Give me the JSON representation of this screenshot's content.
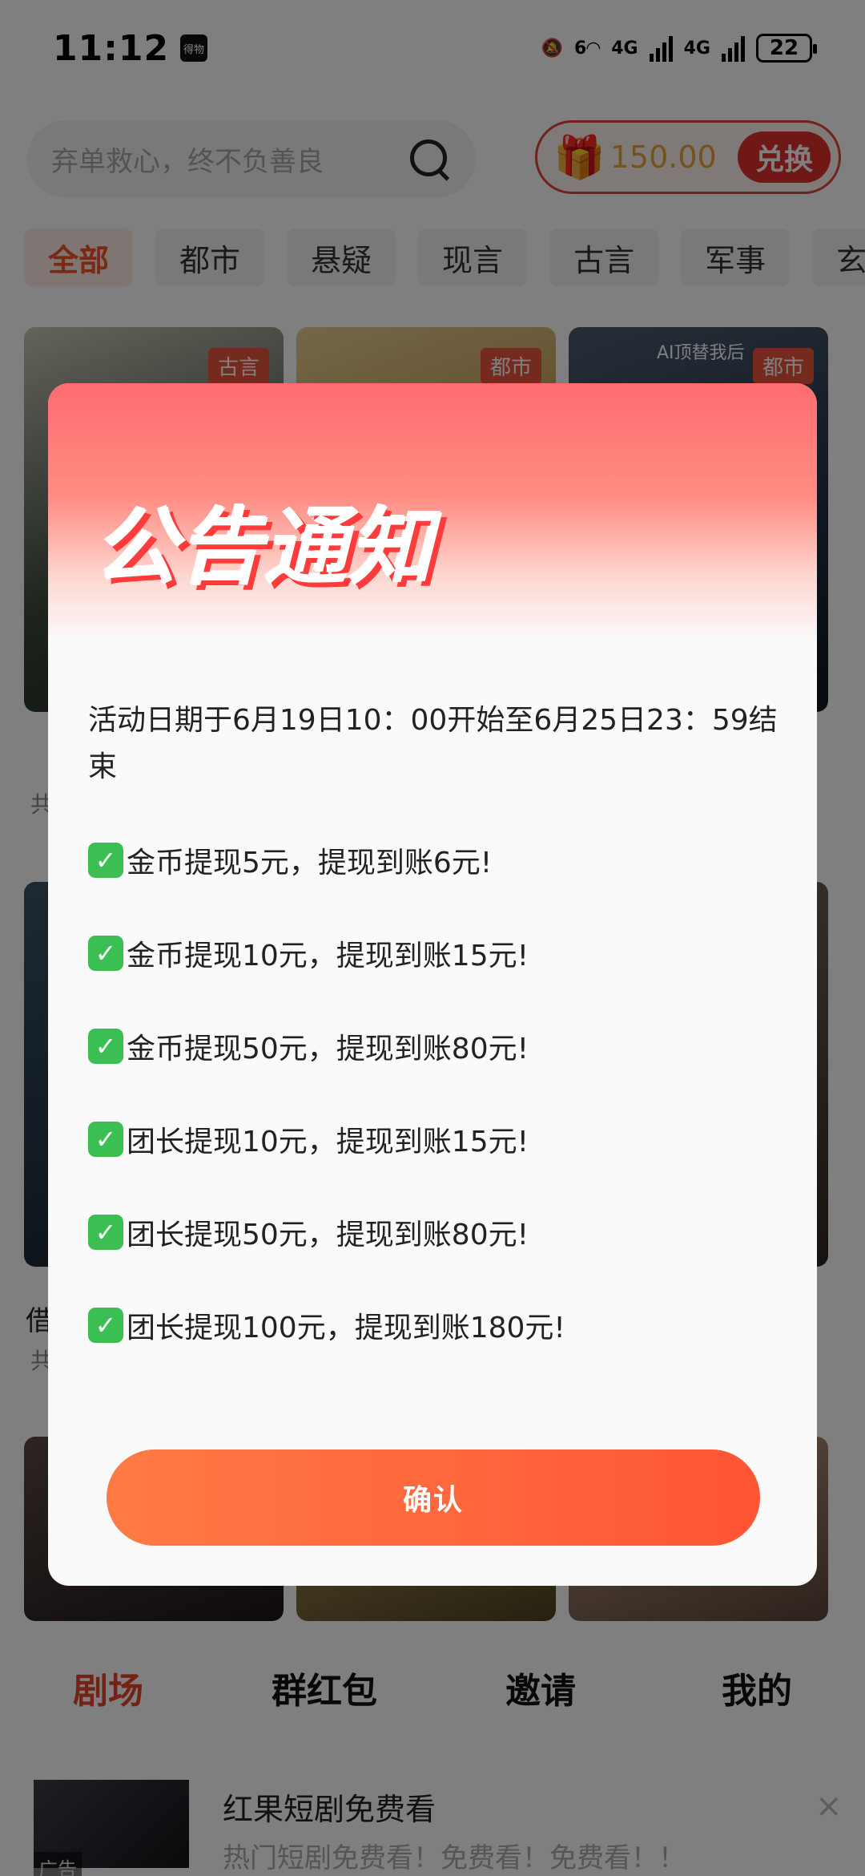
{
  "status_bar": {
    "time": "11:12",
    "app_badge": "得物",
    "network1": "6",
    "network2": "4G",
    "network3": "4G",
    "battery": "22"
  },
  "search": {
    "placeholder": "弃单救心，终不负善良"
  },
  "coins": {
    "amount": "150.00",
    "exchange_label": "兑换"
  },
  "categories": [
    "全部",
    "都市",
    "悬疑",
    "现言",
    "古言",
    "军事",
    "玄"
  ],
  "cards_row1": [
    {
      "tag": "古言",
      "color": "#3b4a3a"
    },
    {
      "tag": "都市",
      "color": "#b98a3c"
    },
    {
      "tag": "都市",
      "color": "#1f2c3c",
      "overlay_text": "AI顶替我后"
    }
  ],
  "card_fragments": {
    "row1_sub": "共",
    "row2_title": "借",
    "row2_sub": "共"
  },
  "bottom_nav": [
    "剧场",
    "群红包",
    "邀请",
    "我的"
  ],
  "ad": {
    "label": "广告",
    "title": "红果短剧免费看",
    "desc": "热门短剧免费看！免费看！免费看！！",
    "close": "×"
  },
  "modal": {
    "title": "公告通知",
    "date_line": "活动日期于6月19日10：00开始至6月25日23：59结束",
    "rules": [
      "金币提现5元，提现到账6元!",
      "金币提现10元，提现到账15元!",
      "金币提现50元，提现到账80元!",
      "团长提现10元，提现到账15元!",
      "团长提现50元，提现到账80元!",
      "团长提现100元，提现到账180元!"
    ],
    "confirm_label": "确认"
  }
}
